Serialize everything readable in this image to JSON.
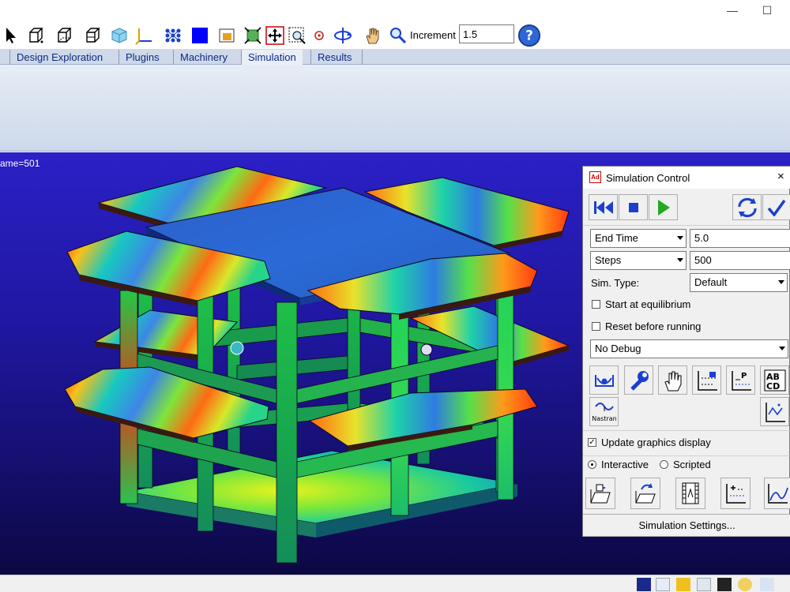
{
  "toolbar": {
    "increment_label": "Increment",
    "increment_value": "1.5",
    "icons": [
      "select-arrow-icon",
      "view-front-icon",
      "view-iso-icon",
      "view-side-icon",
      "solid-cube-icon",
      "axes-icon",
      "mesh-icon",
      "color-square-icon",
      "render-icon",
      "fit-icon",
      "zoom-fit-icon",
      "zoom-box-icon",
      "target-icon",
      "rotate-icon",
      "pan-hand-icon",
      "zoom-icon",
      "help-icon"
    ]
  },
  "tabs": [
    {
      "label": "Design Exploration",
      "active": false
    },
    {
      "label": "Plugins",
      "active": false
    },
    {
      "label": "Machinery",
      "active": false
    },
    {
      "label": "Simulation",
      "active": true
    },
    {
      "label": "Results",
      "active": false
    }
  ],
  "viewport": {
    "frame_label": "ame=501"
  },
  "simulation_control": {
    "title": "Simulation Control",
    "icon_label": "Ad",
    "close": "×",
    "end_time_select": "End Time",
    "end_time_value": "5.0",
    "steps_select": "Steps",
    "steps_value": "500",
    "sim_type_label": "Sim. Type:",
    "sim_type_value": "Default",
    "start_at_equilibrium": "Start at equilibrium",
    "reset_before_running": "Reset before running",
    "debug_value": "No Debug",
    "nastran_label": "Nastran",
    "abcd_label": "ABCD",
    "update_graphics": "Update graphics display",
    "update_graphics_checked": true,
    "mode_interactive": "Interactive",
    "mode_scripted": "Scripted",
    "mode_selected": "Interactive",
    "settings_button": "Simulation Settings..."
  },
  "colors": {
    "tab_text": "#0b2a82",
    "viewport_top": "#2b20c6",
    "viewport_bottom": "#0c0842",
    "accent_blue": "#1a3fd1"
  }
}
